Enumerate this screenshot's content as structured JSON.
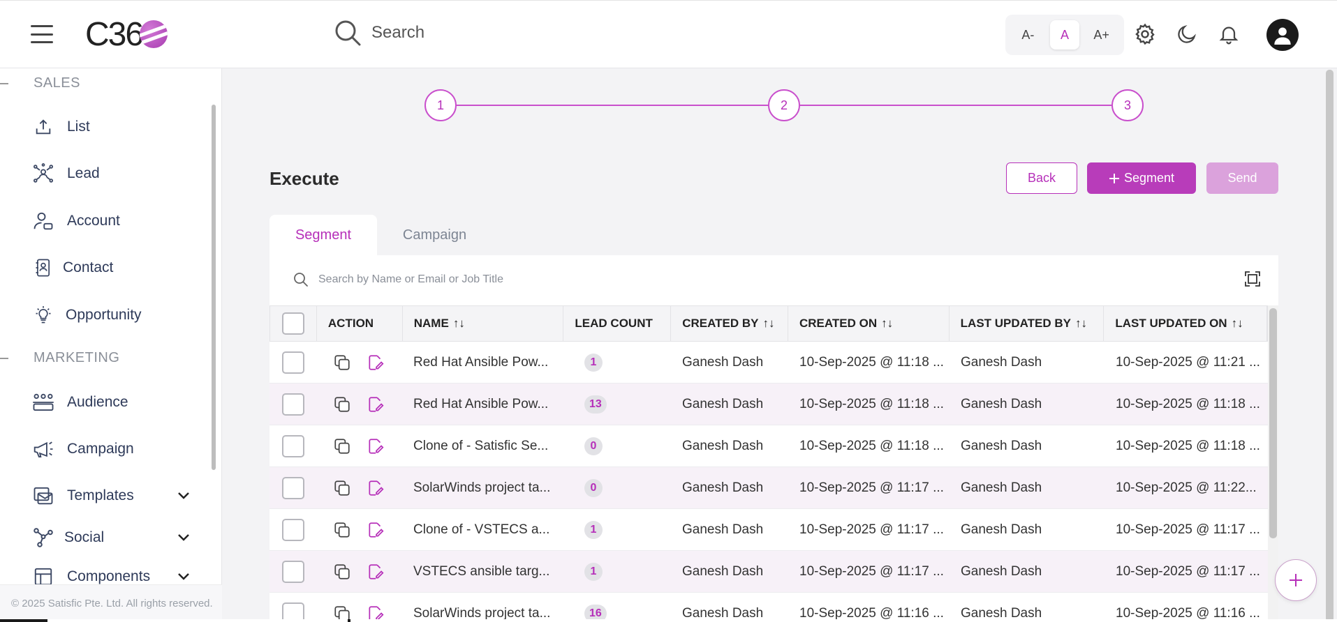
{
  "header": {
    "logo_text": "C36",
    "search_placeholder": "Search",
    "font_controls": {
      "decrease": "A-",
      "normal": "A",
      "increase": "A+"
    }
  },
  "sidebar": {
    "sections": [
      {
        "label": "SALES"
      },
      {
        "label": "MARKETING"
      }
    ],
    "items": [
      {
        "label": "List",
        "icon": "upload-icon"
      },
      {
        "label": "Lead",
        "icon": "network-person-icon"
      },
      {
        "label": "Account",
        "icon": "account-icon"
      },
      {
        "label": "Contact",
        "icon": "contact-book-icon"
      },
      {
        "label": "Opportunity",
        "icon": "lightbulb-icon"
      },
      {
        "label": "Audience",
        "icon": "audience-icon"
      },
      {
        "label": "Campaign",
        "icon": "megaphone-icon"
      },
      {
        "label": "Templates",
        "icon": "template-mail-icon"
      },
      {
        "label": "Social",
        "icon": "social-share-icon"
      },
      {
        "label": "Components",
        "icon": "components-icon"
      }
    ],
    "footer": "© 2025 Satisfic Pte. Ltd. All rights reserved."
  },
  "stepper": {
    "steps": [
      "1",
      "2",
      "3"
    ],
    "active_color": "#c94fcc"
  },
  "page": {
    "title": "Execute",
    "buttons": {
      "back": "Back",
      "segment": "Segment",
      "send": "Send"
    }
  },
  "tabs": [
    {
      "label": "Segment",
      "active": true
    },
    {
      "label": "Campaign",
      "active": false
    }
  ],
  "table": {
    "search_placeholder": "Search by Name or Email or Job Title",
    "columns": [
      "ACTION",
      "NAME",
      "LEAD COUNT",
      "CREATED BY",
      "CREATED ON",
      "LAST UPDATED BY",
      "LAST UPDATED ON"
    ],
    "rows": [
      {
        "name": "Red Hat Ansible Pow...",
        "lead_count": "1",
        "created_by": "Ganesh Dash",
        "created_on": "10-Sep-2025 @ 11:18 ...",
        "last_updated_by": "Ganesh Dash",
        "last_updated_on": "10-Sep-2025 @ 11:21 ..."
      },
      {
        "name": "Red Hat Ansible Pow...",
        "lead_count": "13",
        "created_by": "Ganesh Dash",
        "created_on": "10-Sep-2025 @ 11:18 ...",
        "last_updated_by": "Ganesh Dash",
        "last_updated_on": "10-Sep-2025 @ 11:18 ..."
      },
      {
        "name": "Clone of - Satisfic Se...",
        "lead_count": "0",
        "created_by": "Ganesh Dash",
        "created_on": "10-Sep-2025 @ 11:18 ...",
        "last_updated_by": "Ganesh Dash",
        "last_updated_on": "10-Sep-2025 @ 11:18 ..."
      },
      {
        "name": "SolarWinds project ta...",
        "lead_count": "0",
        "created_by": "Ganesh Dash",
        "created_on": "10-Sep-2025 @ 11:17 ...",
        "last_updated_by": "Ganesh Dash",
        "last_updated_on": "10-Sep-2025 @ 11:22..."
      },
      {
        "name": "Clone of - VSTECS a...",
        "lead_count": "1",
        "created_by": "Ganesh Dash",
        "created_on": "10-Sep-2025 @ 11:17 ...",
        "last_updated_by": "Ganesh Dash",
        "last_updated_on": "10-Sep-2025 @ 11:17 ..."
      },
      {
        "name": "VSTECS ansible targ...",
        "lead_count": "1",
        "created_by": "Ganesh Dash",
        "created_on": "10-Sep-2025 @ 11:17 ...",
        "last_updated_by": "Ganesh Dash",
        "last_updated_on": "10-Sep-2025 @ 11:17 ..."
      },
      {
        "name": "SolarWinds project ta...",
        "lead_count": "16",
        "created_by": "Ganesh Dash",
        "created_on": "10-Sep-2025 @ 11:16 ...",
        "last_updated_by": "Ganesh Dash",
        "last_updated_on": "10-Sep-2025 @ 11:16 ..."
      }
    ]
  },
  "colors": {
    "accent": "#b62fb9",
    "button_primary": "#b83cba",
    "button_disabled": "#dba2dc"
  }
}
